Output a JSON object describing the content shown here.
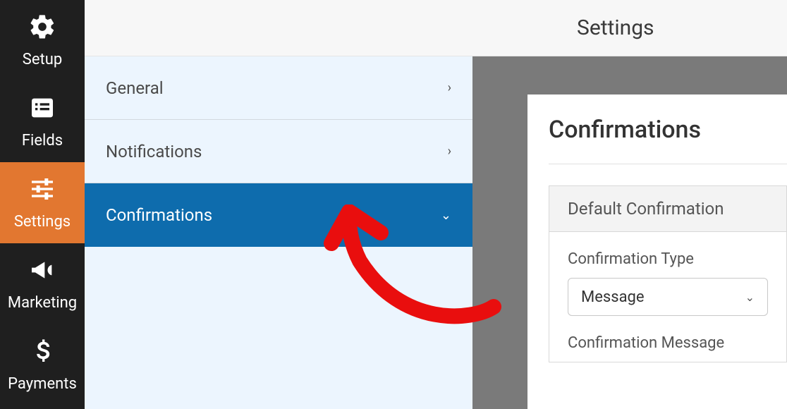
{
  "sidebar": {
    "items": [
      {
        "label": "Setup"
      },
      {
        "label": "Fields"
      },
      {
        "label": "Settings"
      },
      {
        "label": "Marketing"
      },
      {
        "label": "Payments"
      }
    ]
  },
  "settings_list": {
    "items": [
      {
        "label": "General"
      },
      {
        "label": "Notifications"
      },
      {
        "label": "Confirmations"
      }
    ]
  },
  "header": {
    "title": "Settings"
  },
  "panel": {
    "title": "Confirmations",
    "card_header": "Default Confirmation",
    "fields": {
      "type_label": "Confirmation Type",
      "type_value": "Message",
      "message_label": "Confirmation Message"
    }
  },
  "colors": {
    "active_nav": "#e27730",
    "selected_item": "#0e6cad",
    "annotation": "#e90e0e"
  }
}
